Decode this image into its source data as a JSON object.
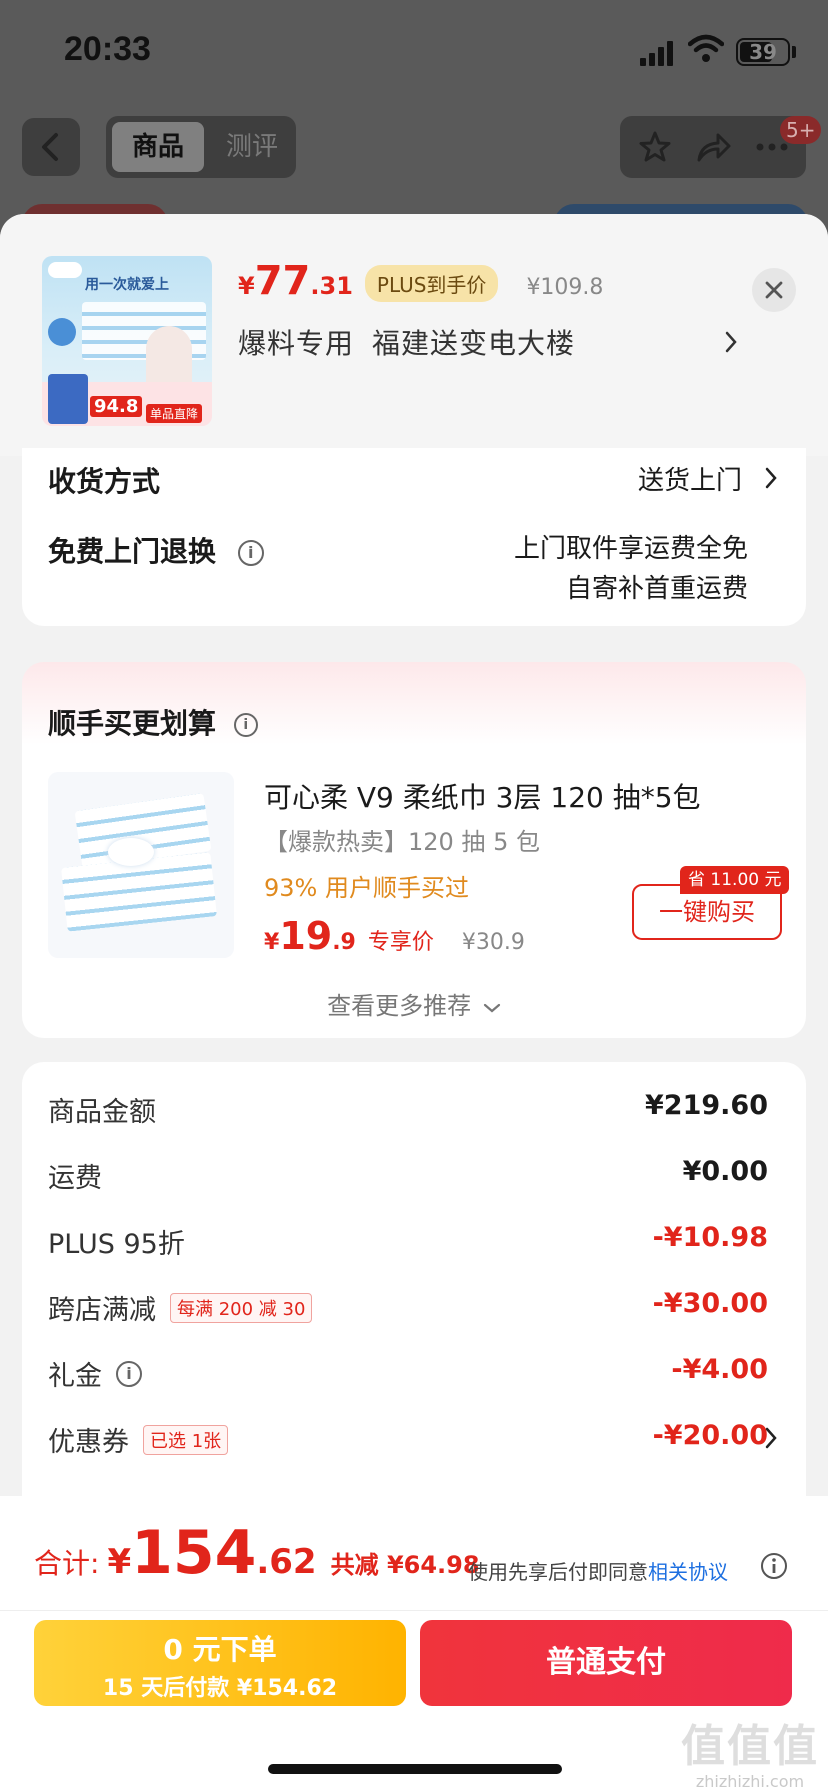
{
  "status_bar": {
    "time": "20:33",
    "battery": "39"
  },
  "nav": {
    "tab_active": "商品",
    "tab_other": "测评",
    "badge": "5+"
  },
  "header": {
    "price_currency": "¥",
    "price_integer": "77",
    "price_decimal": ".31",
    "plus_tag": "PLUS到手价",
    "original_price": "¥109.8",
    "address_tag": "爆料专用",
    "address": "福建送变电大楼",
    "thumb_slogan": "用一次就爱上",
    "thumb_price": "94.8",
    "thumb_cta": "单品直降"
  },
  "delivery": {
    "method_label": "收货方式",
    "method_value": "送货上门",
    "return_label": "免费上门退换",
    "return_line1": "上门取件享运费全免",
    "return_line2": "自寄补首重运费"
  },
  "recommend": {
    "title": "顺手买更划算",
    "product_name": "可心柔 V9 柔纸巾 3层 120 抽*5包",
    "product_sub": "【爆款热卖】120 抽 5 包",
    "stat": "93% 用户顺手买过",
    "price_currency": "¥",
    "price_integer": "19",
    "price_decimal": ".9",
    "price_tag": "专享价",
    "original_price": "¥30.9",
    "save_tag": "省 11.00 元",
    "buy_button": "一键购买",
    "more": "查看更多推荐"
  },
  "fees": [
    {
      "label": "商品金额",
      "value": "¥219.60",
      "red": false
    },
    {
      "label": "运费",
      "value": "¥0.00",
      "red": false
    },
    {
      "label": "PLUS 95折",
      "value": "-¥10.98",
      "red": true
    },
    {
      "label": "跨店满减",
      "tag": "每满 200 减 30",
      "value": "-¥30.00",
      "red": true
    },
    {
      "label": "礼金",
      "value": "-¥4.00",
      "red": true
    },
    {
      "label": "优惠券",
      "tag": "已选 1张",
      "value": "-¥20.00",
      "red": true
    }
  ],
  "bottom": {
    "total_label": "合计:",
    "total_currency": "¥",
    "total_integer": "154",
    "total_decimal": ".62",
    "saved": "共减 ¥64.98",
    "agree_text": "使用先享后付即同意",
    "agree_link": "相关协议",
    "pay_later_line1": "0 元下单",
    "pay_later_line2": "15 天后付款 ¥154.62",
    "pay_button": "普通支付"
  },
  "watermark": {
    "line1": "值值值",
    "line2": "zhizhizhi.com"
  },
  "colors": {
    "accent_red": "#e1251b",
    "pay_later_yellow": "#ffc21a",
    "link_blue": "#1d6fe0",
    "stat_orange": "#e08a1e"
  }
}
